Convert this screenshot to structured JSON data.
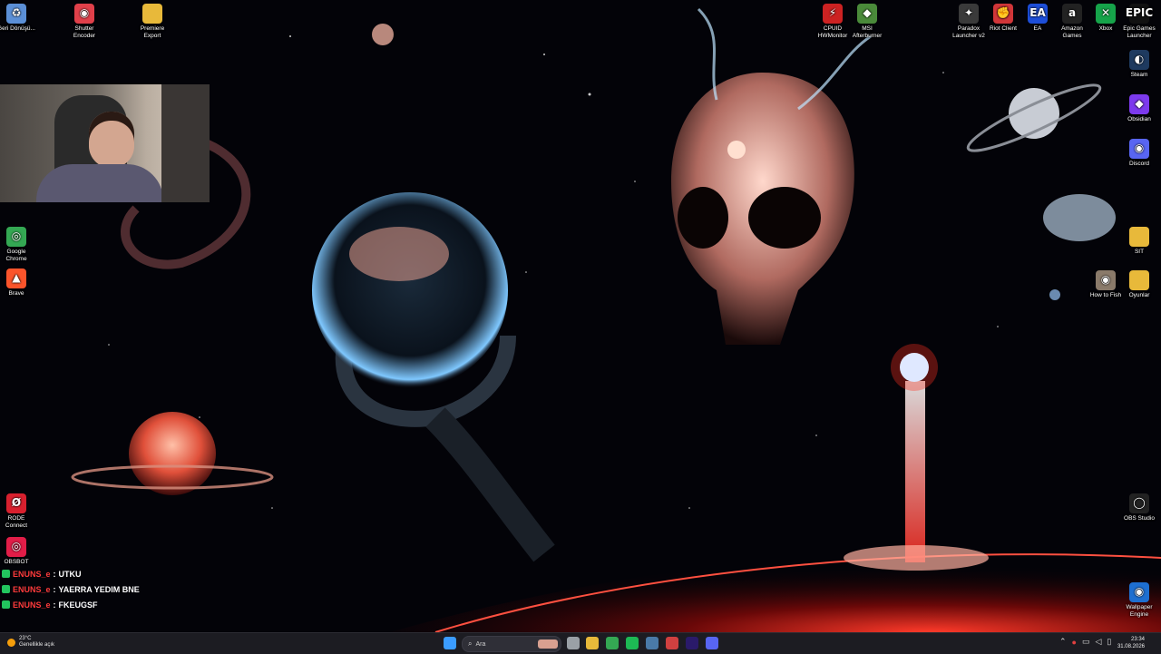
{
  "desktop": {
    "left_icons": [
      {
        "label": "Geri Dönüşü...",
        "icon": "recycle-bin-icon",
        "color": "#5b8fd6"
      },
      {
        "label": "Shutter Encoder",
        "icon": "shutter-encoder-icon",
        "color": "#e0404a"
      },
      {
        "label": "Premiere Export",
        "icon": "folder-icon",
        "color": "#e8b93a"
      },
      {
        "label": "Google Chrome",
        "icon": "chrome-icon",
        "color": "#34a853"
      },
      {
        "label": "Brave",
        "icon": "brave-icon",
        "color": "#fb542b"
      },
      {
        "label": "RODE Connect",
        "icon": "rode-connect-icon",
        "color": "#d8202e"
      },
      {
        "label": "OBSBOT",
        "icon": "obsbot-icon",
        "color": "#e11d48"
      }
    ],
    "right_icons": [
      {
        "label": "CPUID HWMonitor",
        "icon": "hwmonitor-icon",
        "color": "#cc2222"
      },
      {
        "label": "MSI Afterburner",
        "icon": "afterburner-icon",
        "color": "#4a8a3a"
      },
      {
        "label": "Paradox Launcher v2",
        "icon": "paradox-icon",
        "color": "#3a3a3a"
      },
      {
        "label": "Riot Client",
        "icon": "riot-icon",
        "color": "#d13639"
      },
      {
        "label": "EA",
        "icon": "ea-icon",
        "color": "#1d4ed8"
      },
      {
        "label": "Amazon Games",
        "icon": "amazon-games-icon",
        "color": "#222222"
      },
      {
        "label": "Xbox",
        "icon": "xbox-icon",
        "color": "#16a34a"
      },
      {
        "label": "Epic Games Launcher",
        "icon": "epic-games-icon",
        "color": "#111111"
      },
      {
        "label": "Steam",
        "icon": "steam-icon",
        "color": "#1e3a5f"
      },
      {
        "label": "Obsidian",
        "icon": "obsidian-icon",
        "color": "#7c3aed"
      },
      {
        "label": "Discord",
        "icon": "discord-icon",
        "color": "#5865f2"
      },
      {
        "label": "SIT",
        "icon": "folder-icon",
        "color": "#e8b93a"
      },
      {
        "label": "How to Fish",
        "icon": "how-to-fish-icon",
        "color": "#8a7a6a"
      },
      {
        "label": "Oyunlar",
        "icon": "folder-icon",
        "color": "#e8b93a"
      },
      {
        "label": "OBS Studio",
        "icon": "obs-studio-icon",
        "color": "#222222"
      },
      {
        "label": "Wallpaper Engine",
        "icon": "wallpaper-engine-icon",
        "color": "#1e6fd0"
      }
    ]
  },
  "icon_glyphs": {
    "left": [
      "♻",
      "◉",
      "",
      "◎",
      "▲",
      "Ø",
      "◎"
    ],
    "right": [
      "⚡",
      "◆",
      "✦",
      "✊",
      "EA",
      "a",
      "✕",
      "EPIC",
      "◐",
      "◆",
      "◉",
      "",
      "◉",
      "",
      "◯",
      "◉"
    ]
  },
  "chat": [
    {
      "user": "ENUNS_e",
      "message": "UTKU"
    },
    {
      "user": "ENUNS_e",
      "message": "YAERRA YEDIM BNE"
    },
    {
      "user": "ENUNS_e",
      "message": "FKEUGSF"
    }
  ],
  "chat_separator": " : ",
  "taskbar": {
    "weather_temp": "23°C",
    "weather_desc": "Genellikle açık",
    "search_placeholder": "Ara",
    "time": "23:34",
    "date": "31.08.2026"
  },
  "taskbar_apps": [
    {
      "name": "start-button",
      "color": "#3b9cff"
    },
    {
      "name": "task-view-button",
      "color": "#9aa0a6"
    },
    {
      "name": "file-explorer-app",
      "color": "#e8b93a"
    },
    {
      "name": "chrome-app",
      "color": "#34a853"
    },
    {
      "name": "spotify-app",
      "color": "#1db954"
    },
    {
      "name": "steam-app",
      "color": "#4a7aa8"
    },
    {
      "name": "shutter-encoder-app",
      "color": "#d04040"
    },
    {
      "name": "premiere-app",
      "color": "#2a1a6a"
    },
    {
      "name": "discord-app",
      "color": "#5865f2"
    }
  ]
}
